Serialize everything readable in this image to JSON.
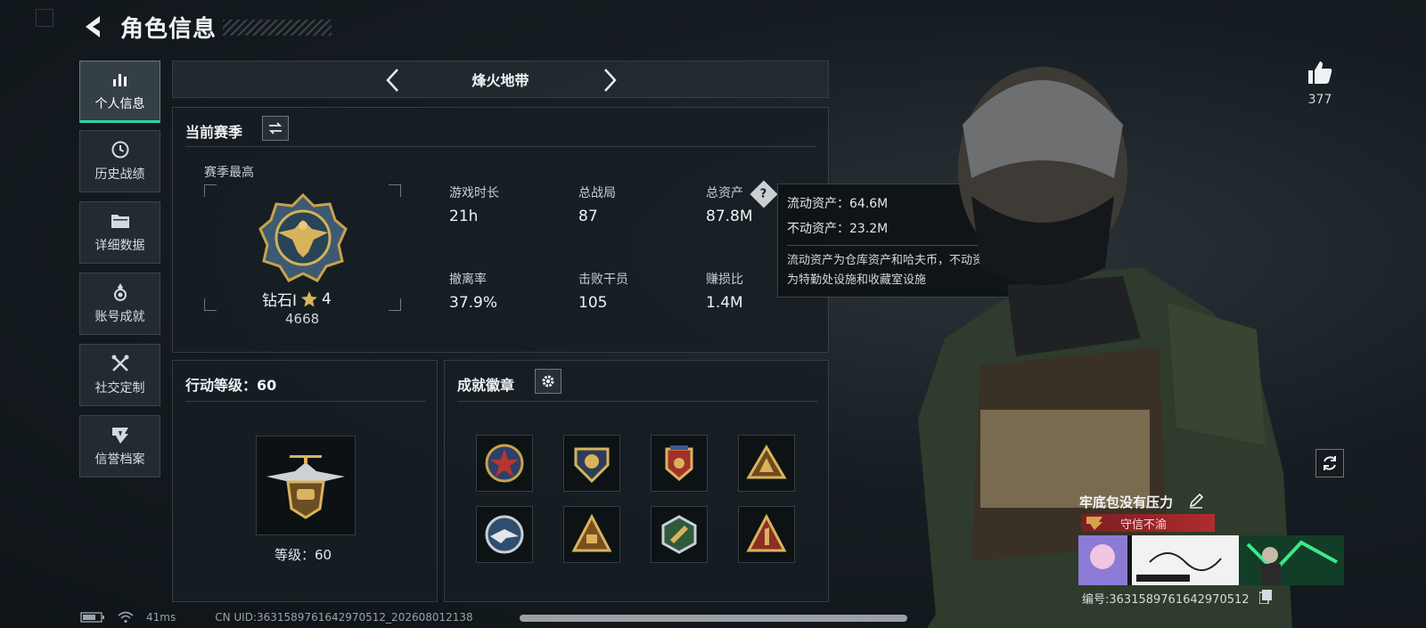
{
  "header": {
    "title": "角色信息"
  },
  "nav": [
    {
      "label": "个人信息",
      "icon": "bar-chart-icon",
      "active": true
    },
    {
      "label": "历史战绩",
      "icon": "clock-history-icon",
      "active": false
    },
    {
      "label": "详细数据",
      "icon": "folder-icon",
      "active": false
    },
    {
      "label": "账号成就",
      "icon": "medal-icon",
      "active": false
    },
    {
      "label": "社交定制",
      "icon": "tools-icon",
      "active": false
    },
    {
      "label": "信誉档案",
      "icon": "shield-emblem-icon",
      "active": false
    }
  ],
  "mode": {
    "name": "烽火地带"
  },
  "season": {
    "title": "当前赛季",
    "peak_label": "赛季最高",
    "rank_name": "钻石Ⅰ",
    "rank_stars": "4",
    "rank_score": "4668",
    "stats": [
      {
        "label": "游戏时长",
        "value": "21h"
      },
      {
        "label": "总战局",
        "value": "87"
      },
      {
        "label": "总资产",
        "value": "87.8M"
      },
      {
        "label": "撤离率",
        "value": "37.9%"
      },
      {
        "label": "击败干员",
        "value": "105"
      },
      {
        "label": "赚损比",
        "value": "1.4M"
      }
    ]
  },
  "tooltip": {
    "liquid": "流动资产：64.6M",
    "fixed": "不动资产：23.2M",
    "note_line1": "流动资产为仓库资产和哈夫币，不动资产",
    "note_line2": "为特勤处设施和收藏室设施"
  },
  "level": {
    "title": "行动等级：60",
    "caption": "等级：60"
  },
  "badges": {
    "title": "成就徽章"
  },
  "profile": {
    "likes": "377",
    "name": "牢底包没有压力",
    "credit": "守信不渝",
    "id": "编号:363158976164297051​2"
  },
  "status": {
    "ping": "41ms",
    "uid": "CN UID:363158976164297051​2_202608012138"
  },
  "colors": {
    "accent": "#2fd3a0",
    "credit_red": "#b02c2f",
    "gold": "#c9a24a"
  }
}
